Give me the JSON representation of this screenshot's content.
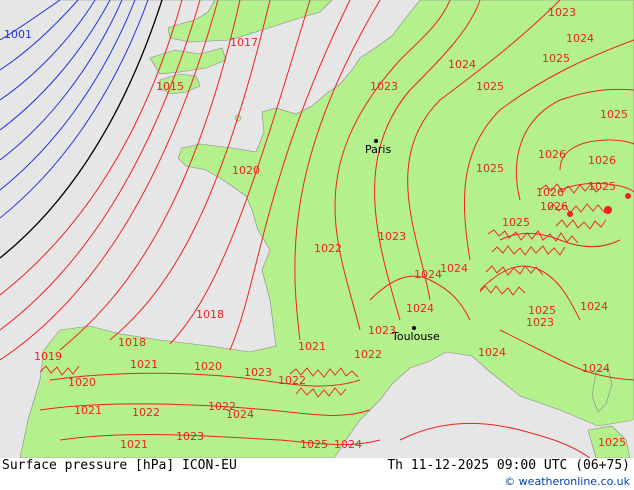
{
  "bottom": {
    "title": "Surface pressure [hPa] ICON-EU",
    "time": "Th 11-12-2025 09:00 UTC (06+75)",
    "credit": "© weatheronline.co.uk"
  },
  "colors": {
    "sea": "#e6e6e6",
    "land": "#b4f08c",
    "isobar_red": "#ee2222",
    "isobar_blue": "#2233dd",
    "isobar_black": "#000000"
  },
  "cities": [
    {
      "name": "Paris"
    },
    {
      "name": "Toulouse"
    }
  ],
  "isobar_labels": [
    {
      "text": "1001",
      "color": "blue"
    },
    {
      "text": "1015",
      "color": "red"
    },
    {
      "text": "1017",
      "color": "red"
    },
    {
      "text": "1018",
      "color": "red"
    },
    {
      "text": "1018",
      "color": "red"
    },
    {
      "text": "1019",
      "color": "red"
    },
    {
      "text": "1020",
      "color": "red"
    },
    {
      "text": "1020",
      "color": "red"
    },
    {
      "text": "1020",
      "color": "red"
    },
    {
      "text": "1021",
      "color": "red"
    },
    {
      "text": "1021",
      "color": "red"
    },
    {
      "text": "1021",
      "color": "red"
    },
    {
      "text": "1022",
      "color": "red"
    },
    {
      "text": "1022",
      "color": "red"
    },
    {
      "text": "1022",
      "color": "red"
    },
    {
      "text": "1022",
      "color": "red"
    },
    {
      "text": "1022",
      "color": "red"
    },
    {
      "text": "1023",
      "color": "red"
    },
    {
      "text": "1023",
      "color": "red"
    },
    {
      "text": "1023",
      "color": "red"
    },
    {
      "text": "1023",
      "color": "red"
    },
    {
      "text": "1023",
      "color": "red"
    },
    {
      "text": "1023",
      "color": "red"
    },
    {
      "text": "1024",
      "color": "red"
    },
    {
      "text": "1024",
      "color": "red"
    },
    {
      "text": "1024",
      "color": "red"
    },
    {
      "text": "1024",
      "color": "red"
    },
    {
      "text": "1024",
      "color": "red"
    },
    {
      "text": "1024",
      "color": "red"
    },
    {
      "text": "1024",
      "color": "red"
    },
    {
      "text": "1024",
      "color": "red"
    },
    {
      "text": "1025",
      "color": "red"
    },
    {
      "text": "1025",
      "color": "red"
    },
    {
      "text": "1025",
      "color": "red"
    },
    {
      "text": "1025",
      "color": "red"
    },
    {
      "text": "1025",
      "color": "red"
    },
    {
      "text": "1025",
      "color": "red"
    },
    {
      "text": "1025",
      "color": "red"
    },
    {
      "text": "1026",
      "color": "red"
    },
    {
      "text": "1026",
      "color": "red"
    },
    {
      "text": "1026",
      "color": "red"
    },
    {
      "text": "1026",
      "color": "red"
    },
    {
      "text": "1024",
      "color": "red"
    },
    {
      "text": "1025",
      "color": "red"
    },
    {
      "text": "1023",
      "color": "red"
    },
    {
      "text": "1024",
      "color": "red"
    },
    {
      "text": "1025",
      "color": "red"
    },
    {
      "text": "1021",
      "color": "red"
    }
  ]
}
